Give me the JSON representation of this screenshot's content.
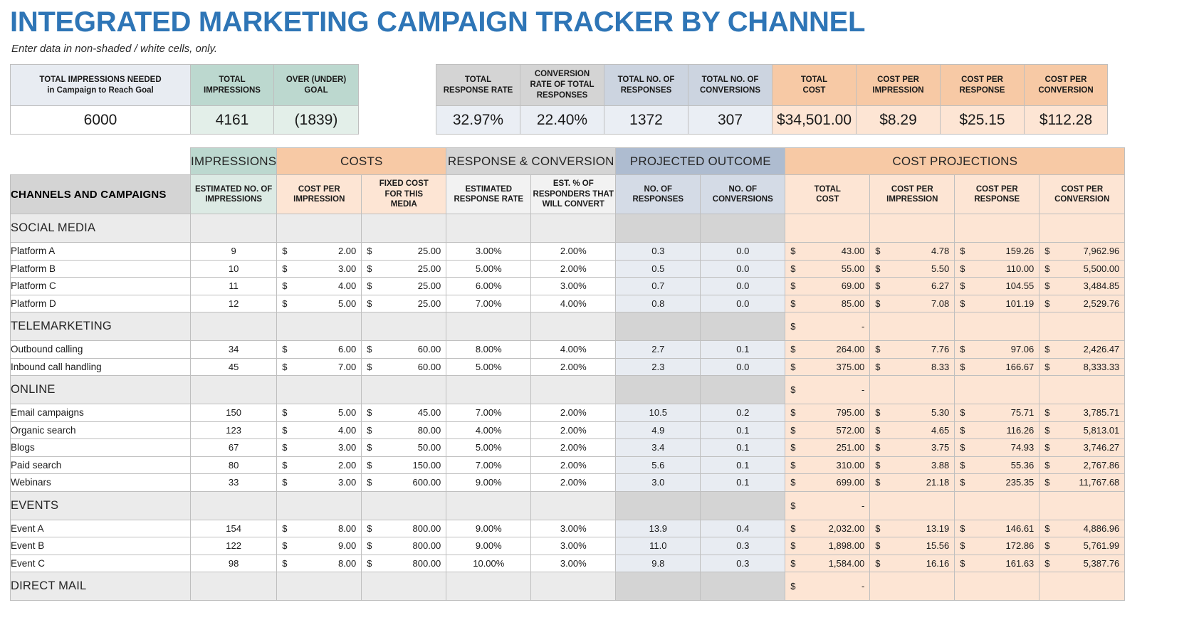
{
  "title": "INTEGRATED MARKETING CAMPAIGN TRACKER BY CHANNEL",
  "subtitle": "Enter data in non-shaded / white cells, only.",
  "colors": {
    "title": "#2e75b6",
    "teal": "#bcd8cf",
    "peach": "#f7c9a5",
    "gray": "#d4d4d4",
    "bluegray": "#aebcd0"
  },
  "summary_left": {
    "headers": [
      "TOTAL IMPRESSIONS NEEDED\nin Campaign to Reach Goal",
      "TOTAL IMPRESSIONS",
      "OVER (UNDER) GOAL"
    ],
    "header_line1": [
      "TOTAL IMPRESSIONS NEEDED",
      "TOTAL IMPRESSIONS",
      "OVER (UNDER) GOAL"
    ],
    "header_line2": [
      "in Campaign to Reach Goal",
      "",
      ""
    ],
    "values": [
      "6000",
      "4161",
      "(1839)"
    ]
  },
  "summary_right": {
    "header_line1": [
      "TOTAL",
      "CONVERSION",
      "TOTAL NO. OF",
      "TOTAL NO. OF",
      "TOTAL",
      "COST PER",
      "COST PER RESPONSE",
      "COST PER"
    ],
    "header_line2": [
      "RESPONSE RATE",
      "RATE OF TOTAL",
      "RESPONSES",
      "CONVERSIONS",
      "COST",
      "IMPRESSION",
      "",
      "CONVERSION"
    ],
    "header_line3": [
      "",
      "RESPONSES",
      "",
      "",
      "",
      "",
      "",
      ""
    ],
    "values": [
      "32.97%",
      "22.40%",
      "1372",
      "307",
      "$34,501.00",
      "$8.29",
      "$25.15",
      "$112.28"
    ]
  },
  "groups": [
    {
      "label": "IMPRESSIONS",
      "span": 1,
      "style": "teal"
    },
    {
      "label": "COSTS",
      "span": 2,
      "style": "peach"
    },
    {
      "label": "RESPONSE & CONVERSION",
      "span": 2,
      "style": "gray"
    },
    {
      "label": "PROJECTED OUTCOME",
      "span": 2,
      "style": "blue"
    },
    {
      "label": "COST PROJECTIONS",
      "span": 4,
      "style": "peach"
    }
  ],
  "columns": {
    "channel": "CHANNELS AND CAMPAIGNS",
    "headers": [
      {
        "l1": "ESTIMATED NO. OF",
        "l2": "IMPRESSIONS",
        "l3": "",
        "style": "teal"
      },
      {
        "l1": "COST PER",
        "l2": "IMPRESSION",
        "l3": "",
        "style": "peach"
      },
      {
        "l1": "FIXED COST",
        "l2": "FOR THIS",
        "l3": "MEDIA",
        "style": "peach"
      },
      {
        "l1": "ESTIMATED",
        "l2": "RESPONSE RATE",
        "l3": "",
        "style": "gray"
      },
      {
        "l1": "EST. % OF",
        "l2": "RESPONDERS THAT",
        "l3": "WILL CONVERT",
        "style": "gray"
      },
      {
        "l1": "NO. OF",
        "l2": "RESPONSES",
        "l3": "",
        "style": "blue"
      },
      {
        "l1": "NO. OF",
        "l2": "CONVERSIONS",
        "l3": "",
        "style": "blue"
      },
      {
        "l1": "TOTAL",
        "l2": "COST",
        "l3": "",
        "style": "peach"
      },
      {
        "l1": "COST PER",
        "l2": "IMPRESSION",
        "l3": "",
        "style": "peach"
      },
      {
        "l1": "COST PER RESPONSE",
        "l2": "",
        "l3": "",
        "style": "peach"
      },
      {
        "l1": "COST PER",
        "l2": "CONVERSION",
        "l3": "",
        "style": "peach"
      }
    ]
  },
  "rows": [
    {
      "type": "section",
      "label": "SOCIAL MEDIA",
      "total_cost_sign": "",
      "total_cost_amt": ""
    },
    {
      "type": "data",
      "label": "Platform A",
      "impressions": "9",
      "cpi_sign": "$",
      "cpi": "2.00",
      "fixed_sign": "$",
      "fixed": "25.00",
      "resp_rate": "3.00%",
      "conv_pct": "2.00%",
      "responses": "0.3",
      "conversions": "0.0",
      "tc_sign": "$",
      "total_cost": "43.00",
      "cpim_sign": "$",
      "cost_per_impression": "4.78",
      "cpr_sign": "$",
      "cost_per_response": "159.26",
      "cpc_sign": "$",
      "cost_per_conversion": "7,962.96"
    },
    {
      "type": "data",
      "label": "Platform B",
      "impressions": "10",
      "cpi_sign": "$",
      "cpi": "3.00",
      "fixed_sign": "$",
      "fixed": "25.00",
      "resp_rate": "5.00%",
      "conv_pct": "2.00%",
      "responses": "0.5",
      "conversions": "0.0",
      "tc_sign": "$",
      "total_cost": "55.00",
      "cpim_sign": "$",
      "cost_per_impression": "5.50",
      "cpr_sign": "$",
      "cost_per_response": "110.00",
      "cpc_sign": "$",
      "cost_per_conversion": "5,500.00"
    },
    {
      "type": "data",
      "label": "Platform C",
      "impressions": "11",
      "cpi_sign": "$",
      "cpi": "4.00",
      "fixed_sign": "$",
      "fixed": "25.00",
      "resp_rate": "6.00%",
      "conv_pct": "3.00%",
      "responses": "0.7",
      "conversions": "0.0",
      "tc_sign": "$",
      "total_cost": "69.00",
      "cpim_sign": "$",
      "cost_per_impression": "6.27",
      "cpr_sign": "$",
      "cost_per_response": "104.55",
      "cpc_sign": "$",
      "cost_per_conversion": "3,484.85"
    },
    {
      "type": "data",
      "label": "Platform D",
      "impressions": "12",
      "cpi_sign": "$",
      "cpi": "5.00",
      "fixed_sign": "$",
      "fixed": "25.00",
      "resp_rate": "7.00%",
      "conv_pct": "4.00%",
      "responses": "0.8",
      "conversions": "0.0",
      "tc_sign": "$",
      "total_cost": "85.00",
      "cpim_sign": "$",
      "cost_per_impression": "7.08",
      "cpr_sign": "$",
      "cost_per_response": "101.19",
      "cpc_sign": "$",
      "cost_per_conversion": "2,529.76"
    },
    {
      "type": "section",
      "label": "TELEMARKETING",
      "total_cost_sign": "$",
      "total_cost_amt": "-"
    },
    {
      "type": "data",
      "label": "Outbound calling",
      "impressions": "34",
      "cpi_sign": "$",
      "cpi": "6.00",
      "fixed_sign": "$",
      "fixed": "60.00",
      "resp_rate": "8.00%",
      "conv_pct": "4.00%",
      "responses": "2.7",
      "conversions": "0.1",
      "tc_sign": "$",
      "total_cost": "264.00",
      "cpim_sign": "$",
      "cost_per_impression": "7.76",
      "cpr_sign": "$",
      "cost_per_response": "97.06",
      "cpc_sign": "$",
      "cost_per_conversion": "2,426.47"
    },
    {
      "type": "data",
      "label": "Inbound call handling",
      "impressions": "45",
      "cpi_sign": "$",
      "cpi": "7.00",
      "fixed_sign": "$",
      "fixed": "60.00",
      "resp_rate": "5.00%",
      "conv_pct": "2.00%",
      "responses": "2.3",
      "conversions": "0.0",
      "tc_sign": "$",
      "total_cost": "375.00",
      "cpim_sign": "$",
      "cost_per_impression": "8.33",
      "cpr_sign": "$",
      "cost_per_response": "166.67",
      "cpc_sign": "$",
      "cost_per_conversion": "8,333.33"
    },
    {
      "type": "section",
      "label": "ONLINE",
      "total_cost_sign": "$",
      "total_cost_amt": "-"
    },
    {
      "type": "data",
      "label": "Email campaigns",
      "impressions": "150",
      "cpi_sign": "$",
      "cpi": "5.00",
      "fixed_sign": "$",
      "fixed": "45.00",
      "resp_rate": "7.00%",
      "conv_pct": "2.00%",
      "responses": "10.5",
      "conversions": "0.2",
      "tc_sign": "$",
      "total_cost": "795.00",
      "cpim_sign": "$",
      "cost_per_impression": "5.30",
      "cpr_sign": "$",
      "cost_per_response": "75.71",
      "cpc_sign": "$",
      "cost_per_conversion": "3,785.71"
    },
    {
      "type": "data",
      "label": "Organic search",
      "impressions": "123",
      "cpi_sign": "$",
      "cpi": "4.00",
      "fixed_sign": "$",
      "fixed": "80.00",
      "resp_rate": "4.00%",
      "conv_pct": "2.00%",
      "responses": "4.9",
      "conversions": "0.1",
      "tc_sign": "$",
      "total_cost": "572.00",
      "cpim_sign": "$",
      "cost_per_impression": "4.65",
      "cpr_sign": "$",
      "cost_per_response": "116.26",
      "cpc_sign": "$",
      "cost_per_conversion": "5,813.01"
    },
    {
      "type": "data",
      "label": "Blogs",
      "impressions": "67",
      "cpi_sign": "$",
      "cpi": "3.00",
      "fixed_sign": "$",
      "fixed": "50.00",
      "resp_rate": "5.00%",
      "conv_pct": "2.00%",
      "responses": "3.4",
      "conversions": "0.1",
      "tc_sign": "$",
      "total_cost": "251.00",
      "cpim_sign": "$",
      "cost_per_impression": "3.75",
      "cpr_sign": "$",
      "cost_per_response": "74.93",
      "cpc_sign": "$",
      "cost_per_conversion": "3,746.27"
    },
    {
      "type": "data",
      "label": "Paid search",
      "impressions": "80",
      "cpi_sign": "$",
      "cpi": "2.00",
      "fixed_sign": "$",
      "fixed": "150.00",
      "resp_rate": "7.00%",
      "conv_pct": "2.00%",
      "responses": "5.6",
      "conversions": "0.1",
      "tc_sign": "$",
      "total_cost": "310.00",
      "cpim_sign": "$",
      "cost_per_impression": "3.88",
      "cpr_sign": "$",
      "cost_per_response": "55.36",
      "cpc_sign": "$",
      "cost_per_conversion": "2,767.86"
    },
    {
      "type": "data",
      "label": "Webinars",
      "impressions": "33",
      "cpi_sign": "$",
      "cpi": "3.00",
      "fixed_sign": "$",
      "fixed": "600.00",
      "resp_rate": "9.00%",
      "conv_pct": "2.00%",
      "responses": "3.0",
      "conversions": "0.1",
      "tc_sign": "$",
      "total_cost": "699.00",
      "cpim_sign": "$",
      "cost_per_impression": "21.18",
      "cpr_sign": "$",
      "cost_per_response": "235.35",
      "cpc_sign": "$",
      "cost_per_conversion": "11,767.68"
    },
    {
      "type": "section",
      "label": "EVENTS",
      "total_cost_sign": "$",
      "total_cost_amt": "-"
    },
    {
      "type": "data",
      "label": "Event A",
      "impressions": "154",
      "cpi_sign": "$",
      "cpi": "8.00",
      "fixed_sign": "$",
      "fixed": "800.00",
      "resp_rate": "9.00%",
      "conv_pct": "3.00%",
      "responses": "13.9",
      "conversions": "0.4",
      "tc_sign": "$",
      "total_cost": "2,032.00",
      "cpim_sign": "$",
      "cost_per_impression": "13.19",
      "cpr_sign": "$",
      "cost_per_response": "146.61",
      "cpc_sign": "$",
      "cost_per_conversion": "4,886.96"
    },
    {
      "type": "data",
      "label": "Event B",
      "impressions": "122",
      "cpi_sign": "$",
      "cpi": "9.00",
      "fixed_sign": "$",
      "fixed": "800.00",
      "resp_rate": "9.00%",
      "conv_pct": "3.00%",
      "responses": "11.0",
      "conversions": "0.3",
      "tc_sign": "$",
      "total_cost": "1,898.00",
      "cpim_sign": "$",
      "cost_per_impression": "15.56",
      "cpr_sign": "$",
      "cost_per_response": "172.86",
      "cpc_sign": "$",
      "cost_per_conversion": "5,761.99"
    },
    {
      "type": "data",
      "label": "Event C",
      "impressions": "98",
      "cpi_sign": "$",
      "cpi": "8.00",
      "fixed_sign": "$",
      "fixed": "800.00",
      "resp_rate": "10.00%",
      "conv_pct": "3.00%",
      "responses": "9.8",
      "conversions": "0.3",
      "tc_sign": "$",
      "total_cost": "1,584.00",
      "cpim_sign": "$",
      "cost_per_impression": "16.16",
      "cpr_sign": "$",
      "cost_per_response": "161.63",
      "cpc_sign": "$",
      "cost_per_conversion": "5,387.76"
    },
    {
      "type": "section",
      "label": "DIRECT MAIL",
      "total_cost_sign": "$",
      "total_cost_amt": "-"
    }
  ]
}
